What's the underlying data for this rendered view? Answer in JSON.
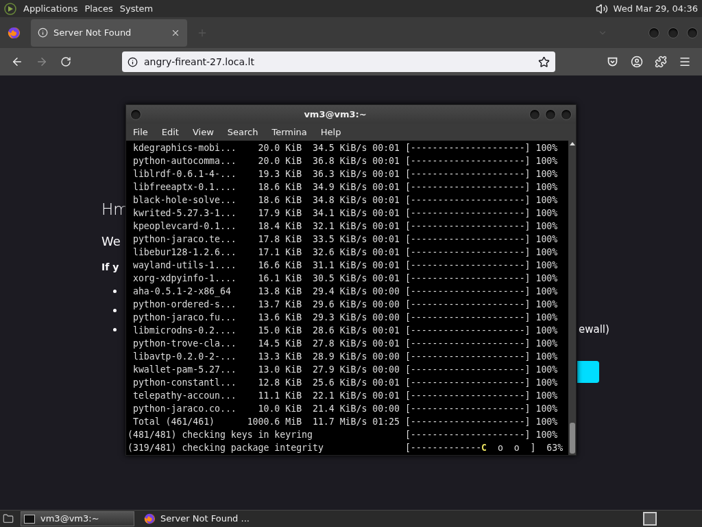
{
  "top_panel": {
    "menus": [
      "Applications",
      "Places",
      "System"
    ],
    "clock": "Wed Mar 29, 04:36"
  },
  "browser": {
    "tabs": [
      {
        "title": "Server Not Found",
        "selected": true
      }
    ],
    "url": "angry-fireant-27.loca.lt",
    "page": {
      "heading": "Hm",
      "intro": "We",
      "bold_line": "If y",
      "bullets": [
        {
          "kind": "hidden"
        },
        {
          "kind": "hidden"
        },
        {
          "kind": "tail",
          "text": "ewall)"
        }
      ]
    }
  },
  "terminal": {
    "title": "vm3@vm3:~",
    "menus": [
      "File",
      "Edit",
      "View",
      "Search",
      "Termina",
      "Help"
    ],
    "lines": [
      {
        "kind": "plain",
        "text": " kdegraphics-mobi...    20.0 KiB  34.5 KiB/s 00:01 [---------------------] 100%"
      },
      {
        "kind": "plain",
        "text": " python-autocomma...    20.0 KiB  36.8 KiB/s 00:01 [---------------------] 100%"
      },
      {
        "kind": "plain",
        "text": " liblrdf-0.6.1-4-...    19.3 KiB  36.3 KiB/s 00:01 [---------------------] 100%"
      },
      {
        "kind": "plain",
        "text": " libfreeaptx-0.1....    18.6 KiB  34.9 KiB/s 00:01 [---------------------] 100%"
      },
      {
        "kind": "plain",
        "text": " black-hole-solve...    18.6 KiB  34.8 KiB/s 00:01 [---------------------] 100%"
      },
      {
        "kind": "plain",
        "text": " kwrited-5.27.3-1...    17.9 KiB  34.1 KiB/s 00:01 [---------------------] 100%"
      },
      {
        "kind": "plain",
        "text": " kpeoplevcard-0.1...    18.4 KiB  32.1 KiB/s 00:01 [---------------------] 100%"
      },
      {
        "kind": "plain",
        "text": " python-jaraco.te...    17.8 KiB  33.5 KiB/s 00:01 [---------------------] 100%"
      },
      {
        "kind": "plain",
        "text": " libebur128-1.2.6...    17.1 KiB  32.6 KiB/s 00:01 [---------------------] 100%"
      },
      {
        "kind": "plain",
        "text": " wayland-utils-1....    16.6 KiB  31.1 KiB/s 00:01 [---------------------] 100%"
      },
      {
        "kind": "plain",
        "text": " xorg-xdpyinfo-1....    16.1 KiB  30.5 KiB/s 00:01 [---------------------] 100%"
      },
      {
        "kind": "plain",
        "text": " aha-0.5.1-2-x86_64     13.8 KiB  29.4 KiB/s 00:00 [---------------------] 100%"
      },
      {
        "kind": "plain",
        "text": " python-ordered-s...    13.7 KiB  29.6 KiB/s 00:00 [---------------------] 100%"
      },
      {
        "kind": "plain",
        "text": " python-jaraco.fu...    13.6 KiB  29.3 KiB/s 00:00 [---------------------] 100%"
      },
      {
        "kind": "plain",
        "text": " libmicrodns-0.2....    15.0 KiB  28.6 KiB/s 00:01 [---------------------] 100%"
      },
      {
        "kind": "plain",
        "text": " python-trove-cla...    14.5 KiB  27.8 KiB/s 00:01 [---------------------] 100%"
      },
      {
        "kind": "plain",
        "text": " libavtp-0.2.0-2-...    13.3 KiB  28.9 KiB/s 00:00 [---------------------] 100%"
      },
      {
        "kind": "plain",
        "text": " kwallet-pam-5.27...    13.0 KiB  27.9 KiB/s 00:00 [---------------------] 100%"
      },
      {
        "kind": "plain",
        "text": " python-constantl...    12.8 KiB  25.6 KiB/s 00:01 [---------------------] 100%"
      },
      {
        "kind": "plain",
        "text": " telepathy-accoun...    11.1 KiB  22.1 KiB/s 00:01 [---------------------] 100%"
      },
      {
        "kind": "plain",
        "text": " python-jaraco.co...    10.0 KiB  21.4 KiB/s 00:00 [---------------------] 100%"
      },
      {
        "kind": "plain",
        "text": " Total (461/461)      1000.6 MiB  11.7 MiB/s 01:25 [---------------------] 100%"
      },
      {
        "kind": "plain",
        "text": "(481/481) checking keys in keyring                 [---------------------] 100%"
      },
      {
        "kind": "pacman",
        "before": "(319/481) checking package integrity               [-------------",
        "pac": "C",
        "after": "  o  o  ]  63%"
      }
    ]
  },
  "taskbar": {
    "items": [
      {
        "label": "vm3@vm3:~",
        "kind": "terminal",
        "selected": true
      },
      {
        "label": "Server Not Found ...",
        "kind": "browser",
        "selected": false
      }
    ]
  }
}
